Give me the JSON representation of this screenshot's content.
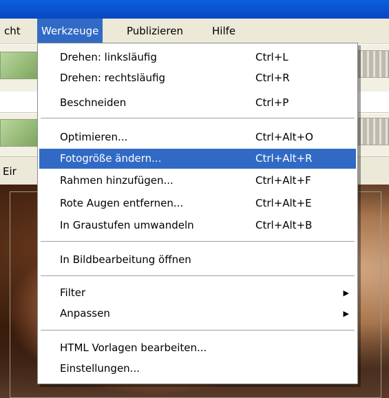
{
  "menubar": {
    "items": [
      {
        "label": "cht"
      },
      {
        "label": "Werkzeuge",
        "active": true
      },
      {
        "label": "Publizieren"
      },
      {
        "label": "Hilfe"
      }
    ]
  },
  "background": {
    "tab_label": "Eir"
  },
  "menu": {
    "items": [
      {
        "label": "Drehen: linksläufig",
        "shortcut": "Ctrl+L"
      },
      {
        "label": "Drehen: rechtsläufig",
        "shortcut": "Ctrl+R"
      },
      {
        "label": "Beschneiden",
        "shortcut": "Ctrl+P"
      },
      {
        "label": "Optimieren...",
        "shortcut": "Ctrl+Alt+O"
      },
      {
        "label": "Fotogröße ändern...",
        "shortcut": "Ctrl+Alt+R",
        "highlighted": true
      },
      {
        "label": "Rahmen hinzufügen...",
        "shortcut": "Ctrl+Alt+F"
      },
      {
        "label": "Rote Augen entfernen...",
        "shortcut": "Ctrl+Alt+E"
      },
      {
        "label": "In Graustufen umwandeln",
        "shortcut": "Ctrl+Alt+B"
      },
      {
        "label": "In Bildbearbeitung öffnen",
        "shortcut": ""
      },
      {
        "label": "Filter",
        "shortcut": "",
        "submenu": true
      },
      {
        "label": "Anpassen",
        "shortcut": "",
        "submenu": true
      },
      {
        "label": "HTML Vorlagen bearbeiten...",
        "shortcut": ""
      },
      {
        "label": "Einstellungen...",
        "shortcut": ""
      }
    ],
    "submenu_arrow": "▶",
    "highlight_color": "#316ac5"
  }
}
